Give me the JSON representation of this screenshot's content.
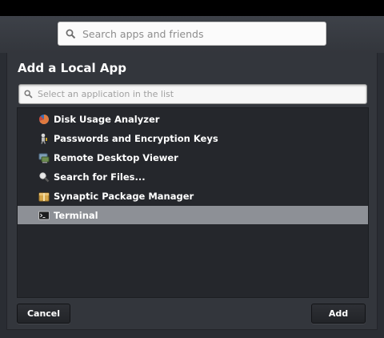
{
  "header": {
    "search": {
      "placeholder": "Search apps and friends",
      "icon": "search-icon"
    }
  },
  "dialog": {
    "title": "Add a Local App",
    "filter": {
      "placeholder": "Select an application in the list",
      "icon": "search-icon"
    },
    "apps": [
      {
        "label": "Disk Usage Analyzer",
        "icon": "pie-chart-icon",
        "selected": false
      },
      {
        "label": "Passwords and Encryption Keys",
        "icon": "key-person-icon",
        "selected": false
      },
      {
        "label": "Remote Desktop Viewer",
        "icon": "remote-desktop-icon",
        "selected": false
      },
      {
        "label": "Search for Files...",
        "icon": "magnifier-icon",
        "selected": false
      },
      {
        "label": "Synaptic Package Manager",
        "icon": "package-icon",
        "selected": false
      },
      {
        "label": "Terminal",
        "icon": "terminal-icon",
        "selected": true
      }
    ],
    "buttons": {
      "cancel": "Cancel",
      "add": "Add"
    }
  },
  "colors": {
    "background": "#2a2d33",
    "list_background": "#25272c",
    "selected_row": "#8d9096",
    "text": "#ffffff"
  }
}
